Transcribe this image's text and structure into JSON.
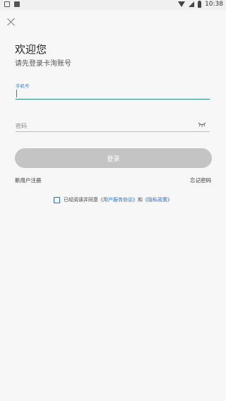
{
  "status_bar": {
    "time": "10:38",
    "icons": [
      "image-icon",
      "notification-icon",
      "wifi-icon",
      "signal-icon",
      "battery-icon"
    ]
  },
  "header": {
    "close_icon": "close-icon",
    "title": "欢迎您",
    "subtitle": "请先登录卡洵账号"
  },
  "form": {
    "phone_label": "手机号",
    "phone_value": "",
    "password_placeholder": "密码",
    "password_value": "",
    "eye_icon": "eye-closed-icon",
    "login_label": "登录"
  },
  "links": {
    "register": "新用户注册",
    "forgot": "忘记密码"
  },
  "agreement": {
    "prefix": "已经阅读并同意",
    "user_agreement": "《用户服务协议》",
    "and": "和",
    "privacy": "《隐私政策》"
  },
  "colors": {
    "accent": "#2a8a7c",
    "link": "#2a6fc5",
    "button_disabled": "#c4c4c4",
    "background": "#f7f7f7"
  }
}
